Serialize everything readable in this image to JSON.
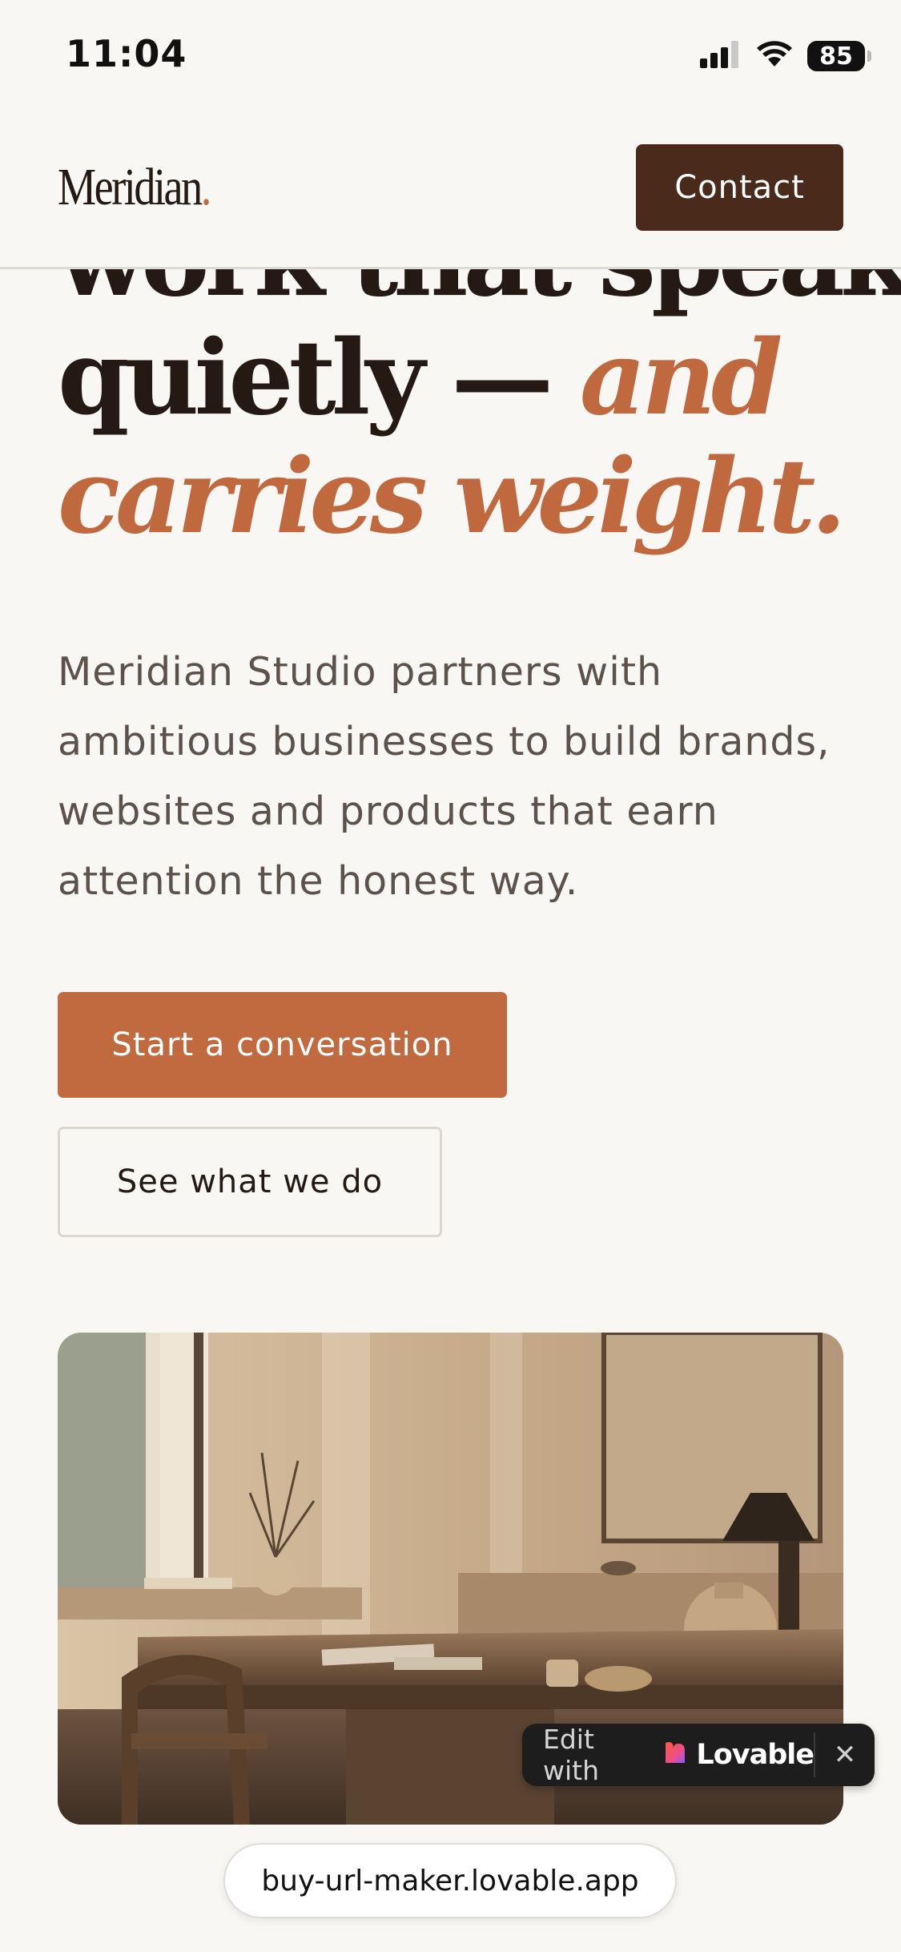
{
  "status_bar": {
    "time": "11:04",
    "battery": "85",
    "icons": [
      "signal-icon",
      "wifi-icon",
      "battery-icon"
    ]
  },
  "header": {
    "logo_text": "Meridian",
    "logo_dot": ".",
    "contact_label": "Contact"
  },
  "hero": {
    "heading_line1": "work that speaks",
    "heading_line2_plain": "quietly — ",
    "heading_line2_accent": "and",
    "heading_line3_accent": "carries weight.",
    "body": "Meridian Studio partners with ambitious businesses to build brands, websites and products that earn attention the honest way.",
    "primary_cta": "Start a conversation",
    "secondary_cta": "See what we do"
  },
  "lovable_badge": {
    "edit_label": "Edit with",
    "brand_name": "Lovable",
    "close_symbol": "✕"
  },
  "url_bar": {
    "url": "buy-url-maker.lovable.app"
  },
  "colors": {
    "background": "#f9f7f3",
    "accent": "#c1693f",
    "dark_brown": "#4a2b1b",
    "heading": "#241913",
    "body_text": "#5d524b"
  }
}
